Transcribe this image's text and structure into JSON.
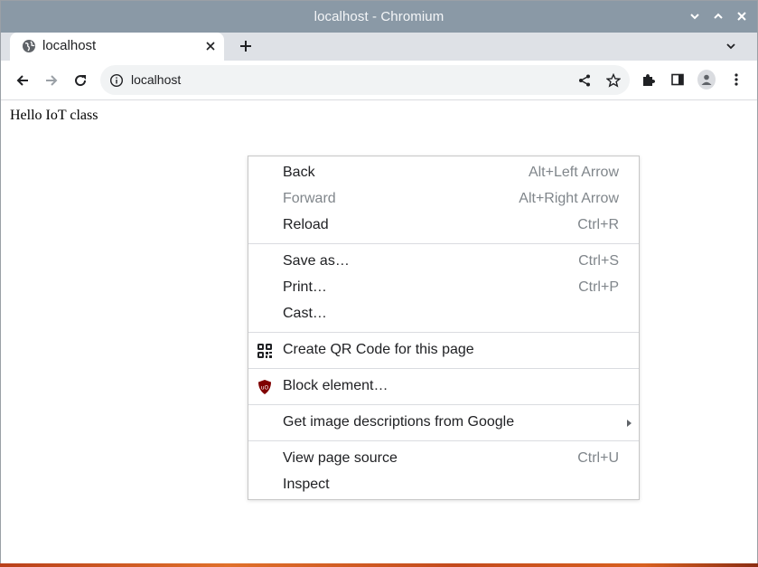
{
  "window": {
    "title": "localhost - Chromium"
  },
  "tabs": [
    {
      "title": "localhost",
      "favicon": "globe-icon"
    }
  ],
  "toolbar": {
    "url": "localhost"
  },
  "page": {
    "text": "Hello IoT class"
  },
  "context_menu": {
    "items": [
      {
        "label": "Back",
        "accel": "Alt+Left Arrow",
        "enabled": true
      },
      {
        "label": "Forward",
        "accel": "Alt+Right Arrow",
        "enabled": false
      },
      {
        "label": "Reload",
        "accel": "Ctrl+R",
        "enabled": true
      },
      {
        "label": "Save as…",
        "accel": "Ctrl+S",
        "enabled": true
      },
      {
        "label": "Print…",
        "accel": "Ctrl+P",
        "enabled": true
      },
      {
        "label": "Cast…",
        "accel": "",
        "enabled": true
      },
      {
        "label": "Create QR Code for this page",
        "accel": "",
        "enabled": true,
        "icon": "qr-code-icon"
      },
      {
        "label": "Block element…",
        "accel": "",
        "enabled": true,
        "icon": "ublock-origin-icon"
      },
      {
        "label": "Get image descriptions from Google",
        "accel": "",
        "enabled": true,
        "submenu": true
      },
      {
        "label": "View page source",
        "accel": "Ctrl+U",
        "enabled": true
      },
      {
        "label": "Inspect",
        "accel": "",
        "enabled": true
      }
    ]
  },
  "colors": {
    "titlebar": "#8a99a6",
    "tabstrip": "#dee1e6",
    "omnibox": "#f1f3f4",
    "ublock_red": "#800000"
  }
}
